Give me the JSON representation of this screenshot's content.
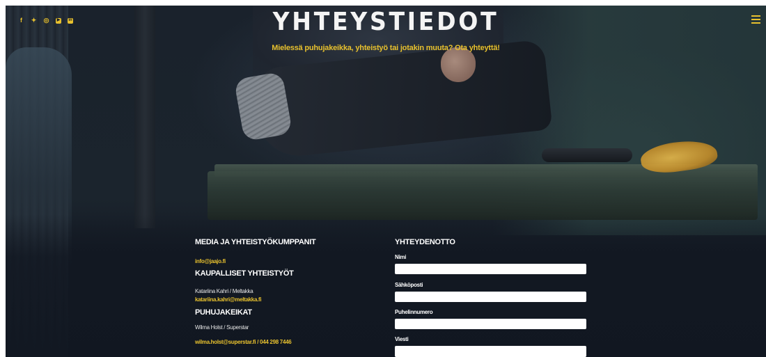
{
  "header": {
    "title": "YHTEYSTIEDOT",
    "subtitle": "Mielessä puhujakeikka, yhteistyö tai jotakin muuta? Ota yhteyttä!",
    "social_icons": [
      {
        "name": "facebook-icon",
        "glyph": "f"
      },
      {
        "name": "twitter-icon",
        "glyph": "✦"
      },
      {
        "name": "instagram-icon",
        "glyph": "◎"
      },
      {
        "name": "youtube-icon",
        "glyph": "▶"
      },
      {
        "name": "linkedin-icon",
        "glyph": "in"
      }
    ],
    "menu_icon": "hamburger-menu-icon"
  },
  "info": {
    "media_heading": "MEDIA JA YHTEISTYÖKUMPPANIT",
    "media_email": "info@jaajo.fi",
    "commercial_heading": "KAUPALLISET YHTEISTYÖT",
    "commercial_name": "Katariina Kahri / Meltakka",
    "commercial_email": "katariina.kahri@meltakka.fi",
    "speaking_heading": "PUHUJAKEIKAT",
    "speaking_name": "Wilma Holst / Superstar",
    "speaking_contact": "wilma.holst@superstar.fi / 044 298 7446"
  },
  "form": {
    "heading": "YHTEYDENOTTO",
    "name_label": "Nimi",
    "name_value": "",
    "email_label": "Sähköposti",
    "email_value": "",
    "phone_label": "Puhelinnumero",
    "phone_value": "",
    "message_label": "Viesti",
    "message_value": ""
  },
  "colors": {
    "accent": "#e8c12e",
    "background": "#151b26",
    "text": "#ffffff"
  }
}
